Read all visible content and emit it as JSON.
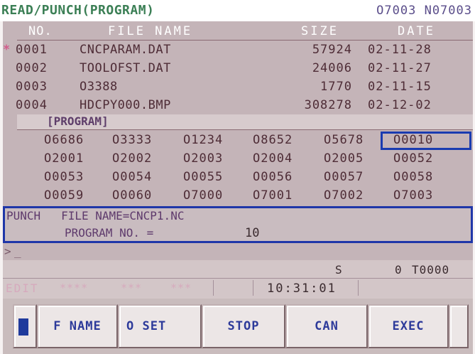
{
  "header": {
    "title": "READ/PUNCH(PROGRAM)",
    "status": "O7003 N07003"
  },
  "file_table": {
    "columns": [
      "NO.",
      "FILE NAME",
      "SIZE",
      "DATE"
    ],
    "rows": [
      {
        "no": "0001",
        "name": "CNCPARAM.DAT",
        "size": "57924",
        "date": "02-11-28"
      },
      {
        "no": "0002",
        "name": "TOOLOFST.DAT",
        "size": "24006",
        "date": "02-11-27"
      },
      {
        "no": "0003",
        "name": "O3388",
        "size": "1770",
        "date": "02-11-15"
      },
      {
        "no": "0004",
        "name": "HDCPY000.BMP",
        "size": "308278",
        "date": "02-12-02"
      }
    ],
    "cursor_marker": "*"
  },
  "program_list": {
    "label": "[PROGRAM]",
    "rows": [
      [
        "O6686",
        "O3333",
        "O1234",
        "O8652",
        "O5678",
        "O0010"
      ],
      [
        "O2001",
        "O2002",
        "O2003",
        "O2004",
        "O2005",
        "O0052"
      ],
      [
        "O0053",
        "O0054",
        "O0055",
        "O0056",
        "O0057",
        "O0058"
      ],
      [
        "O0059",
        "O0060",
        "O7000",
        "O7001",
        "O7002",
        "O7003"
      ]
    ],
    "selected": "O0010"
  },
  "punch": {
    "line1": "PUNCH   FILE NAME=CNCP1.NC",
    "line2_label": "PROGRAM NO. =",
    "program_no": "10"
  },
  "input_line": {
    "prompt": ">",
    "cursor": "_"
  },
  "status": {
    "s_label": "S",
    "s_value": "0",
    "tool": "T0000",
    "mode": "EDIT",
    "field1": "****",
    "field2": "***",
    "field3": "***",
    "time": "10:31:01"
  },
  "softkeys": [
    "F NAME",
    "O SET",
    "STOP",
    "CAN",
    "EXEC"
  ],
  "colors": {
    "screen_bg": "#c4b4b8",
    "title_green": "#3b7f55",
    "highlight_blue": "#1a3bb0",
    "softkey_text": "#2d3a9a"
  }
}
